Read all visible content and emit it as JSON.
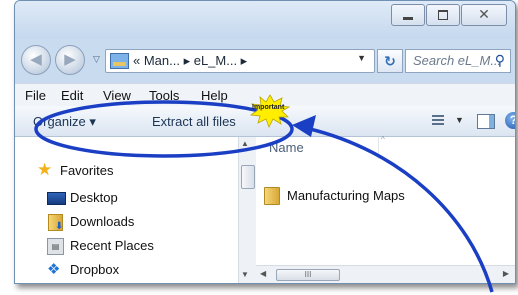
{
  "addressbar": {
    "crumbs": "«  Man...  ▸  eL_M...  ▸",
    "dropdown": "▼"
  },
  "search": {
    "placeholder": "Search eL_M..."
  },
  "menubar": {
    "items": [
      "File",
      "Edit",
      "View",
      "Tools",
      "Help"
    ]
  },
  "commandbar": {
    "organize": "Organize ▾",
    "extract": "Extract all files"
  },
  "annotation": {
    "burst_text": "Important"
  },
  "navpane": {
    "items": [
      {
        "label": "Favorites",
        "icon": "star-icon"
      },
      {
        "label": "Desktop",
        "icon": "desktop-icon"
      },
      {
        "label": "Downloads",
        "icon": "downloads-icon"
      },
      {
        "label": "Recent Places",
        "icon": "recent-places-icon"
      },
      {
        "label": "Dropbox",
        "icon": "dropbox-icon"
      }
    ]
  },
  "filepane": {
    "column_name": "Name",
    "files": [
      {
        "name": "Manufacturing Maps",
        "icon": "folder-icon"
      }
    ]
  },
  "colors": {
    "annotation_blue": "#1a3fc4",
    "burst_yellow": "#ffee00",
    "window_frame": "#c9dbee"
  }
}
